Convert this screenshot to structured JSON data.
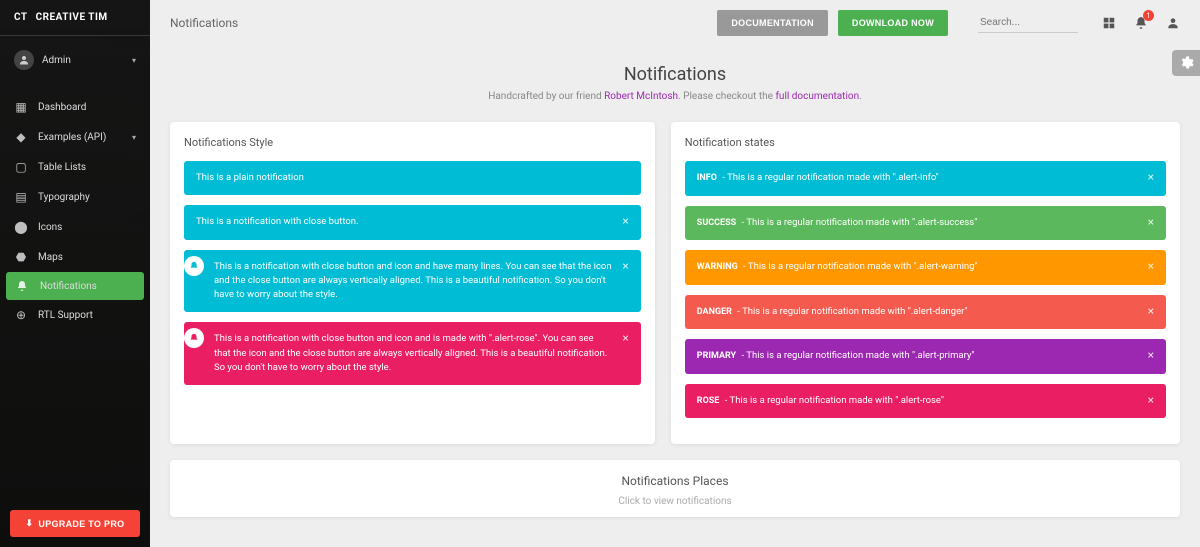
{
  "brand": {
    "logo": "CT",
    "name": "CREATIVE TIM"
  },
  "user": {
    "name": "Admin"
  },
  "sidebar": {
    "items": [
      {
        "label": "Dashboard",
        "icon": "dashboard"
      },
      {
        "label": "Examples (API)",
        "icon": "widgets",
        "expandable": true
      },
      {
        "label": "Table Lists",
        "icon": "clipboard"
      },
      {
        "label": "Typography",
        "icon": "text"
      },
      {
        "label": "Icons",
        "icon": "bubble"
      },
      {
        "label": "Maps",
        "icon": "pin"
      },
      {
        "label": "Notifications",
        "icon": "bell",
        "active": true
      },
      {
        "label": "RTL Support",
        "icon": "globe"
      }
    ],
    "upgrade": "UPGRADE TO PRO"
  },
  "topbar": {
    "title": "Notifications",
    "doc_btn": "DOCUMENTATION",
    "download_btn": "DOWNLOAD NOW",
    "search_placeholder": "Search...",
    "notif_count": "1"
  },
  "header": {
    "title": "Notifications",
    "sub_pre": "Handcrafted by our friend ",
    "sub_link1": "Robert McIntosh",
    "sub_mid": ". Please checkout the ",
    "sub_link2": "full documentation",
    "sub_end": "."
  },
  "styles_card": {
    "title": "Notifications Style",
    "alerts": {
      "plain": "This is a plain notification",
      "close": "This is a notification with close button.",
      "icon_close": "This is a notification with close button and icon and have many lines. You can see that the icon and the close button are always vertically aligned. This is a beautiful notification. So you don't have to worry about the style.",
      "rose": "This is a notification with close button and icon and is made with \".alert-rose\". You can see that the icon and the close button are always vertically aligned. This is a beautiful notification. So you don't have to worry about the style."
    }
  },
  "states_card": {
    "title": "Notification states",
    "msg": " - This is a regular notification made with ",
    "items": [
      {
        "tag": "INFO",
        "cls": "\".alert-info\"",
        "bg": "alert-info-bg"
      },
      {
        "tag": "SUCCESS",
        "cls": "\".alert-success\"",
        "bg": "alert-success-bg"
      },
      {
        "tag": "WARNING",
        "cls": "\".alert-warning\"",
        "bg": "alert-warning-bg"
      },
      {
        "tag": "DANGER",
        "cls": "\".alert-danger\"",
        "bg": "alert-danger-bg"
      },
      {
        "tag": "PRIMARY",
        "cls": "\".alert-primary\"",
        "bg": "alert-primary-bg"
      },
      {
        "tag": "ROSE",
        "cls": "\".alert-rose\"",
        "bg": "alert-rose-bg"
      }
    ]
  },
  "places": {
    "title": "Notifications Places",
    "sub": "Click to view notifications"
  }
}
